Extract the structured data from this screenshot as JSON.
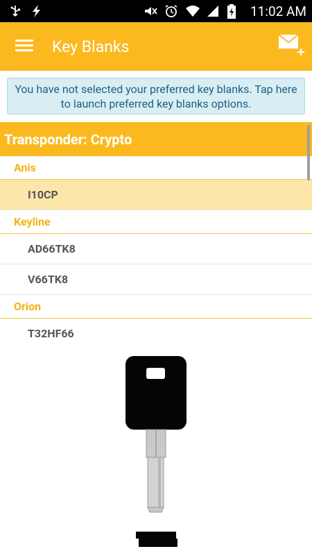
{
  "status_bar": {
    "time": "11:02 AM",
    "left_icons": [
      "usb-icon",
      "flash-icon"
    ],
    "right_icons": [
      "mute-icon",
      "alarm-icon",
      "wifi-icon",
      "signal-icon",
      "battery-charging-icon"
    ]
  },
  "app_bar": {
    "title": "Key Blanks",
    "menu_icon": "hamburger-menu-icon",
    "action_icon": "compose-mail-icon"
  },
  "notice": {
    "text": "You have not selected your preferred key blanks. Tap here to launch preferred key blanks options."
  },
  "list": {
    "section": "Transponder: Crypto",
    "groups": [
      {
        "name": "Anis",
        "items": [
          {
            "label": "I10CP",
            "selected": true
          }
        ]
      },
      {
        "name": "Keyline",
        "items": [
          {
            "label": "AD66TK8"
          },
          {
            "label": "V66TK8"
          }
        ]
      },
      {
        "name": "Orion",
        "items": [
          {
            "label": "T32HF66"
          }
        ]
      }
    ]
  },
  "colors": {
    "accent": "#FBB91F",
    "selected_row": "#FDE6AA",
    "notice_bg": "#D8EEF2",
    "notice_text": "#1F5E86",
    "group_text": "#F4B215"
  }
}
